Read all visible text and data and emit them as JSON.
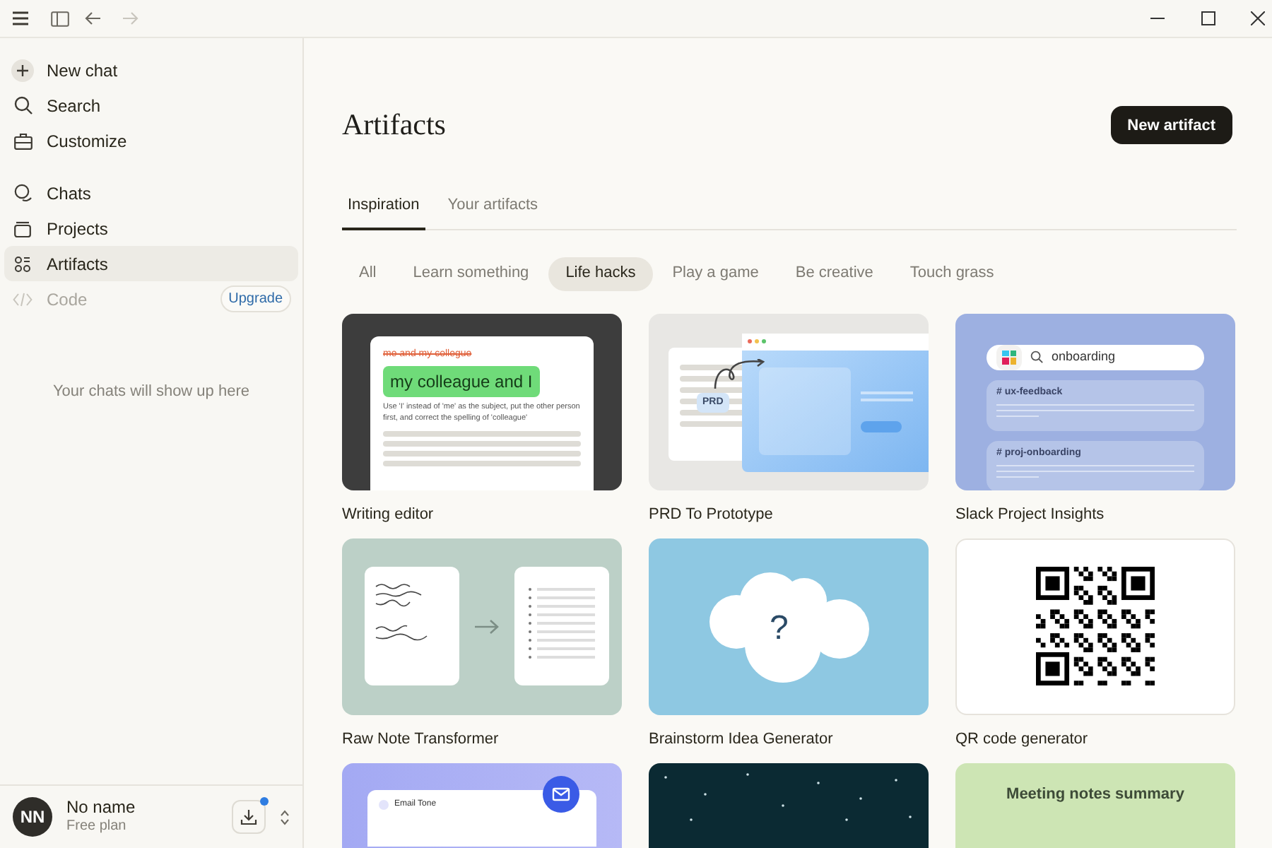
{
  "sidebar": {
    "top_items": [
      {
        "label": "New chat"
      },
      {
        "label": "Search"
      },
      {
        "label": "Customize"
      }
    ],
    "nav_items": [
      {
        "label": "Chats",
        "selected": false,
        "disabled": false
      },
      {
        "label": "Projects",
        "selected": false,
        "disabled": false
      },
      {
        "label": "Artifacts",
        "selected": true,
        "disabled": false
      },
      {
        "label": "Code",
        "selected": false,
        "disabled": true,
        "badge": "Upgrade"
      }
    ],
    "empty_text": "Your chats will show up here",
    "user": {
      "initials": "NN",
      "name": "No name",
      "plan": "Free plan"
    },
    "download_notification": true
  },
  "main": {
    "title": "Artifacts",
    "new_button": "New artifact",
    "tabs": [
      {
        "label": "Inspiration",
        "selected": true
      },
      {
        "label": "Your artifacts",
        "selected": false
      }
    ],
    "filters": [
      {
        "label": "All",
        "selected": false
      },
      {
        "label": "Learn something",
        "selected": false
      },
      {
        "label": "Life hacks",
        "selected": true
      },
      {
        "label": "Play a game",
        "selected": false
      },
      {
        "label": "Be creative",
        "selected": false
      },
      {
        "label": "Touch grass",
        "selected": false
      }
    ],
    "cards": [
      {
        "kind": "writing",
        "title": "Writing editor",
        "texts": [
          "me and my collegue",
          "my colleague and I",
          "Use 'I' instead of 'me' as the subject, put the other person first, and correct the spelling of 'colleague'"
        ]
      },
      {
        "kind": "prd",
        "title": "PRD To Prototype",
        "texts": [
          "PRD"
        ]
      },
      {
        "kind": "slack",
        "title": "Slack Project Insights",
        "texts": [
          "onboarding",
          "# ux-feedback",
          "# proj-onboarding"
        ]
      },
      {
        "kind": "notes",
        "title": "Raw Note Transformer"
      },
      {
        "kind": "brainstorm",
        "title": "Brainstorm Idea Generator",
        "texts": [
          "?"
        ]
      },
      {
        "kind": "qr",
        "title": "QR code generator"
      },
      {
        "kind": "email",
        "texts": [
          "Email Tone"
        ]
      },
      {
        "kind": "stars"
      },
      {
        "kind": "meeting",
        "texts": [
          "Meeting notes summary"
        ]
      }
    ]
  }
}
